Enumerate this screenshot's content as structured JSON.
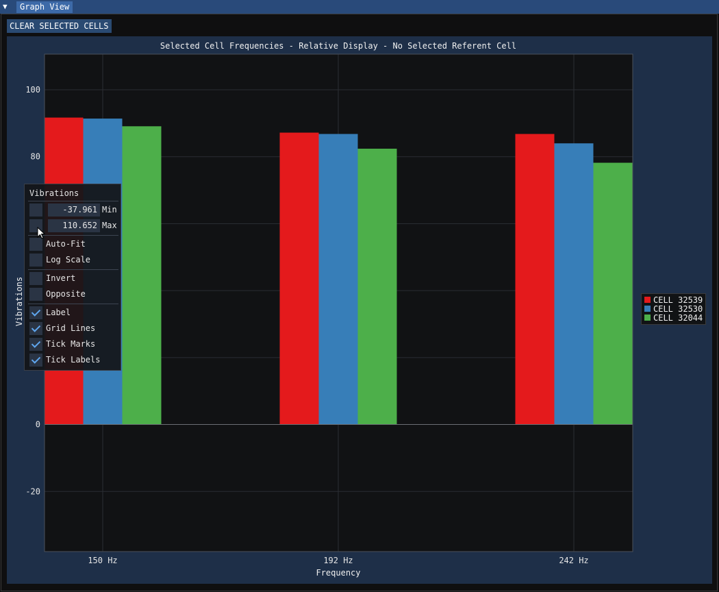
{
  "window": {
    "tab_label": "Graph View"
  },
  "toolbar": {
    "clear_label": "CLEAR SELECTED CELLS"
  },
  "plot": {
    "title": "Selected Cell Frequencies - Relative Display - No Selected Referent Cell"
  },
  "popup": {
    "title": "Vibrations",
    "min_value": "-37.961",
    "min_label": "Min",
    "max_value": "110.652",
    "max_label": "Max",
    "options": [
      {
        "label": "Auto-Fit",
        "checked": false
      },
      {
        "label": "Log Scale",
        "checked": false
      },
      {
        "label": "Invert",
        "checked": false
      },
      {
        "label": "Opposite",
        "checked": false
      },
      {
        "label": "Label",
        "checked": true
      },
      {
        "label": "Grid Lines",
        "checked": true
      },
      {
        "label": "Tick Marks",
        "checked": true
      },
      {
        "label": "Tick Labels",
        "checked": true
      }
    ]
  },
  "colors": {
    "series1": "#e41a1c",
    "series2": "#377eb8",
    "series3": "#4daf4a",
    "plot_bg": "#111214",
    "frame_bg": "#1e2f48",
    "accent": "#5fa6ee"
  },
  "chart_data": {
    "type": "bar",
    "title": "Selected Cell Frequencies - Relative Display - No Selected Referent Cell",
    "xlabel": "Frequency",
    "ylabel": "Vibrations",
    "categories": [
      "150 Hz",
      "192 Hz",
      "242 Hz"
    ],
    "series": [
      {
        "name": "CELL 32539",
        "values": [
          91.7,
          87.2,
          86.8
        ]
      },
      {
        "name": "CELL 32530",
        "values": [
          91.4,
          86.8,
          84.0
        ]
      },
      {
        "name": "CELL 32044",
        "values": [
          89.1,
          82.4,
          78.2
        ]
      }
    ],
    "ylim": [
      -37.961,
      110.652
    ],
    "yticks": [
      -20,
      0,
      20,
      40,
      60,
      80,
      100
    ],
    "ytick_labels": [
      "-20",
      "0",
      "",
      "",
      "",
      "80",
      "100"
    ],
    "grid": true,
    "legend_position": "right"
  }
}
